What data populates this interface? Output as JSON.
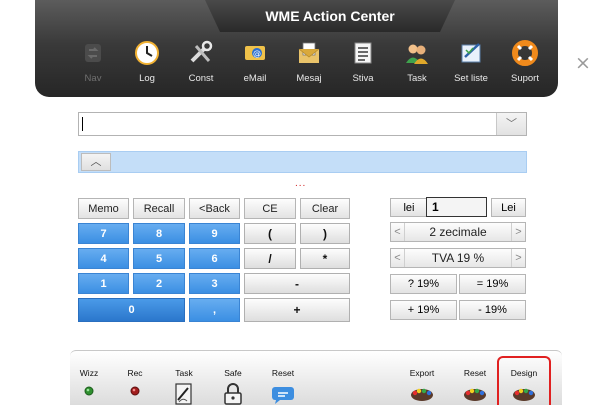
{
  "window": {
    "title": "WME Action Center",
    "close_symbol": "×"
  },
  "toolbar": {
    "items": [
      {
        "label": "Nav",
        "icon": "refresh-icon",
        "disabled": true
      },
      {
        "label": "Log",
        "icon": "clock-icon"
      },
      {
        "label": "Const",
        "icon": "tools-icon"
      },
      {
        "label": "eMail",
        "icon": "email-icon"
      },
      {
        "label": "Mesaj",
        "icon": "envelope-icon"
      },
      {
        "label": "Stiva",
        "icon": "list-icon"
      },
      {
        "label": "Task",
        "icon": "users-icon"
      },
      {
        "label": "Set liste",
        "icon": "checklist-icon"
      },
      {
        "label": "Suport",
        "icon": "lifebuoy-icon"
      }
    ]
  },
  "combo": {
    "value": "",
    "button_symbol": "﹀"
  },
  "panel": {
    "toggle_symbol": "︿"
  },
  "indicator": {
    "dots": "..."
  },
  "keypad": {
    "row1": [
      "Memo",
      "Recall",
      "<Back",
      "CE",
      "Clear"
    ],
    "digits": {
      "k7": "7",
      "k8": "8",
      "k9": "9",
      "k4": "4",
      "k5": "5",
      "k6": "6",
      "k1": "1",
      "k2": "2",
      "k3": "3",
      "k0": "0",
      "dot": ","
    },
    "ops": {
      "lparen": "(",
      "rparen": ")",
      "div": "/",
      "mul": "*",
      "minus": "-",
      "plus": "+"
    }
  },
  "converter": {
    "unit_label": "lei",
    "amount": "1",
    "convert_button": "Lei",
    "decimals": "2 zecimale",
    "vat": "TVA 19 %",
    "left_arrow": "<",
    "right_arrow": ">",
    "vat_buttons": [
      "? 19%",
      "= 19%",
      "+ 19%",
      "- 19%"
    ]
  },
  "bottom": {
    "items": [
      {
        "label": "Wizz",
        "icon": "green-led-icon"
      },
      {
        "label": "Rec",
        "icon": "red-led-icon"
      },
      {
        "label": "Task",
        "icon": "notepad-icon"
      },
      {
        "label": "Safe",
        "icon": "padlock-icon"
      },
      {
        "label": "Reset",
        "icon": "chat-bubble-icon"
      },
      {
        "label": "Export",
        "icon": "palette-icon"
      },
      {
        "label": "Reset",
        "icon": "palette-icon"
      },
      {
        "label": "Design",
        "icon": "palette-icon"
      }
    ]
  },
  "colors": {
    "accent_blue": "#3b8fe3",
    "panel_blue": "#c4def8",
    "highlight_red": "#e02020",
    "header_dark": "#2e2e2e"
  }
}
